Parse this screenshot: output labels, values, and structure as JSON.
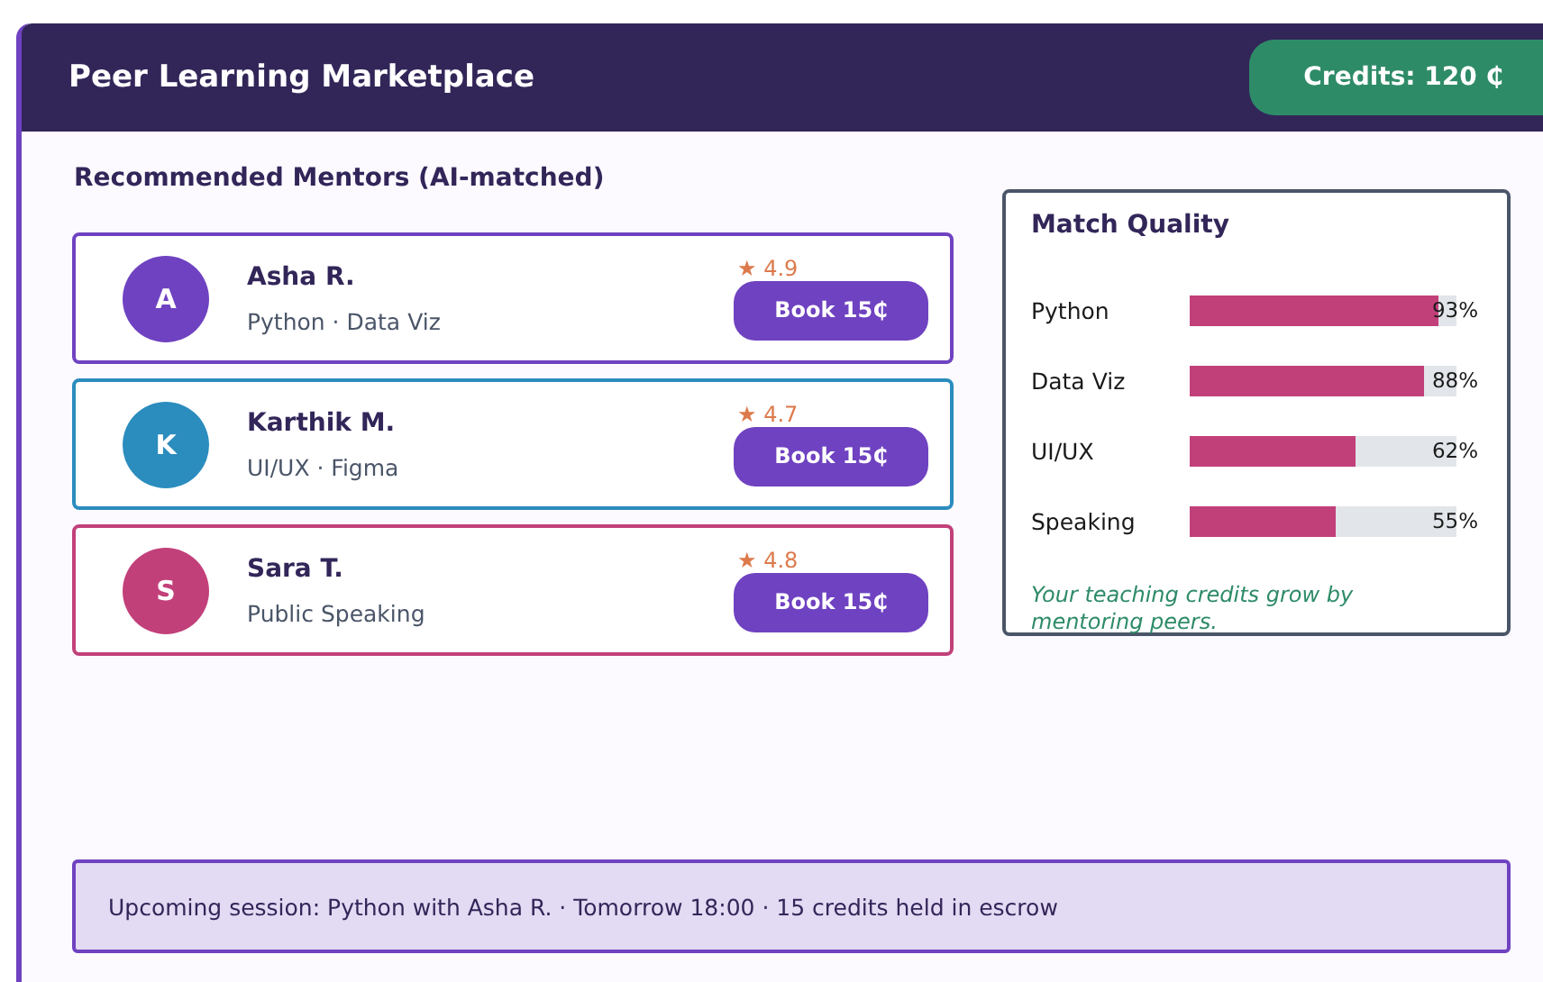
{
  "header": {
    "title": "Peer Learning Marketplace",
    "credits": "Credits: 120 ₵"
  },
  "mentors_section": {
    "title": "Recommended Mentors (AI-matched)",
    "mentors": [
      {
        "initial": "A",
        "name": "Asha R.",
        "skills": "Python · Data Viz",
        "rating": "★ 4.9",
        "button": "Book 15₵",
        "color": "#6f42c1"
      },
      {
        "initial": "K",
        "name": "Karthik M.",
        "skills": "UI/UX · Figma",
        "rating": "★ 4.7",
        "button": "Book 15₵",
        "color": "#2b8cbe"
      },
      {
        "initial": "S",
        "name": "Sara T.",
        "skills": "Public Speaking",
        "rating": "★ 4.8",
        "button": "Book 15₵",
        "color": "#c2407a"
      }
    ]
  },
  "match_quality": {
    "title": "Match Quality",
    "rows": [
      {
        "label": "Python",
        "level": 0.93,
        "reading": "93%"
      },
      {
        "label": "Data Viz",
        "level": 0.88,
        "reading": "88%"
      },
      {
        "label": "UI/UX",
        "level": 0.62,
        "reading": "62%"
      },
      {
        "label": "Speaking",
        "level": 0.55,
        "reading": "55%"
      }
    ],
    "note": "Your teaching credits grow by mentoring peers."
  },
  "footer": {
    "text": "Upcoming session: Python with Asha R. · Tomorrow 18:00 · 15 credits held in escrow"
  }
}
